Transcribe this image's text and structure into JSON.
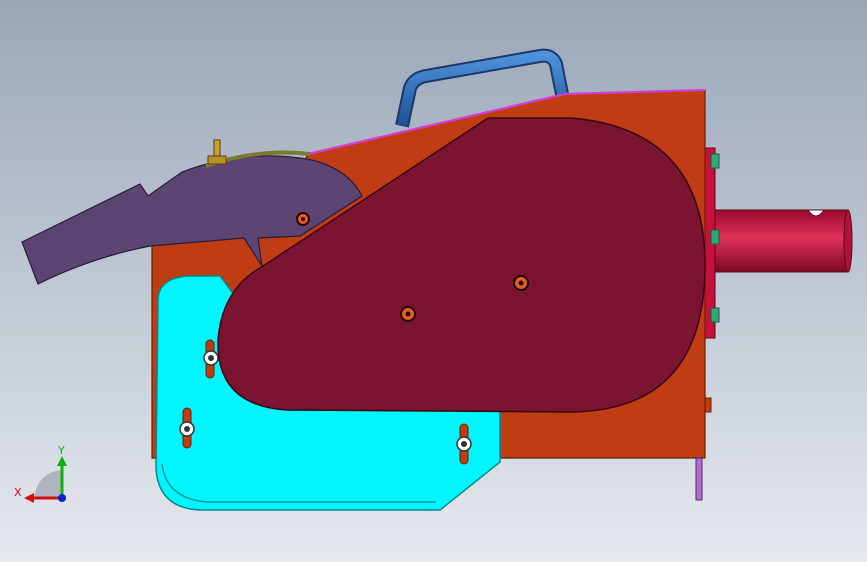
{
  "view": {
    "background_top": "#9aa6b8",
    "background_bottom": "#e6e9ee"
  },
  "model": {
    "parts": [
      {
        "name": "housing-body",
        "color": "#c03c12"
      },
      {
        "name": "cover-plate",
        "color": "#7b1430"
      },
      {
        "name": "guard-plate",
        "color": "#00f5ff"
      },
      {
        "name": "lever-arm",
        "color": "#5c4572"
      },
      {
        "name": "carry-handle",
        "color": "#2a6fbd"
      },
      {
        "name": "drive-shaft",
        "color": "#c8103c"
      },
      {
        "name": "top-rail",
        "color": "#d43cd0"
      }
    ]
  },
  "triad": {
    "x_label": "X",
    "y_label": "Y",
    "x_color": "#d01010",
    "y_color": "#10b010",
    "z_color": "#1020d0"
  }
}
